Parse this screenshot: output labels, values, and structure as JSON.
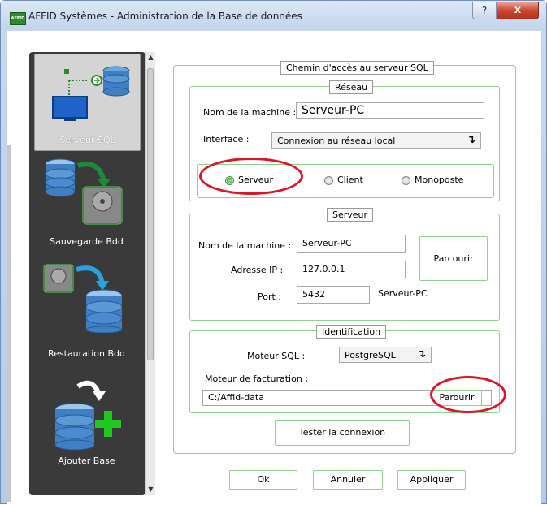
{
  "window": {
    "title": "AFFID Systèmes - Administration de la Base de données",
    "app_icon_text": "AFFID",
    "help_glyph": "?",
    "close_glyph": "x"
  },
  "sidebar": {
    "items": [
      {
        "label": "Serveur SQL",
        "icon": "server-network-icon",
        "active": true
      },
      {
        "label": "Sauvegarde Bdd",
        "icon": "database-to-disk-icon"
      },
      {
        "label": "Restauration Bdd",
        "icon": "disk-to-database-icon"
      },
      {
        "label": "Ajouter Base",
        "icon": "add-database-icon"
      }
    ]
  },
  "main": {
    "title": "Chemin d'accès au serveur SQL",
    "reseau": {
      "legend": "Réseau",
      "machine_label": "Nom de la machine :",
      "machine_value": "Serveur-PC",
      "interface_label": "Interface :",
      "interface_value": "Connexion au réseau local",
      "radios": [
        {
          "label": "Serveur",
          "checked": true
        },
        {
          "label": "Client",
          "checked": false
        },
        {
          "label": "Monoposte",
          "checked": false
        }
      ]
    },
    "serveur": {
      "legend": "Serveur",
      "machine_label": "Nom de la machine :",
      "machine_value": "Serveur-PC",
      "ip_label": "Adresse IP :",
      "ip_value": "127.0.0.1",
      "port_label": "Port :",
      "port_value": "5432",
      "port_host": "Serveur-PC",
      "browse_label": "Parcourir"
    },
    "identification": {
      "legend": "Identification",
      "engine_label": "Moteur SQL :",
      "engine_value": "PostgreSQL",
      "billing_label": "Moteur de facturation :",
      "billing_value": "C:/Affid-data",
      "browse_label": "Parourir"
    },
    "test_label": "Tester la connexion"
  },
  "footer": {
    "ok_label": "Ok",
    "cancel_label": "Annuler",
    "apply_label": "Appliquer"
  },
  "colors": {
    "accent_green": "#8ed18e",
    "annotation_red": "#d9162a",
    "sidebar_bg": "#3a3a3a"
  }
}
